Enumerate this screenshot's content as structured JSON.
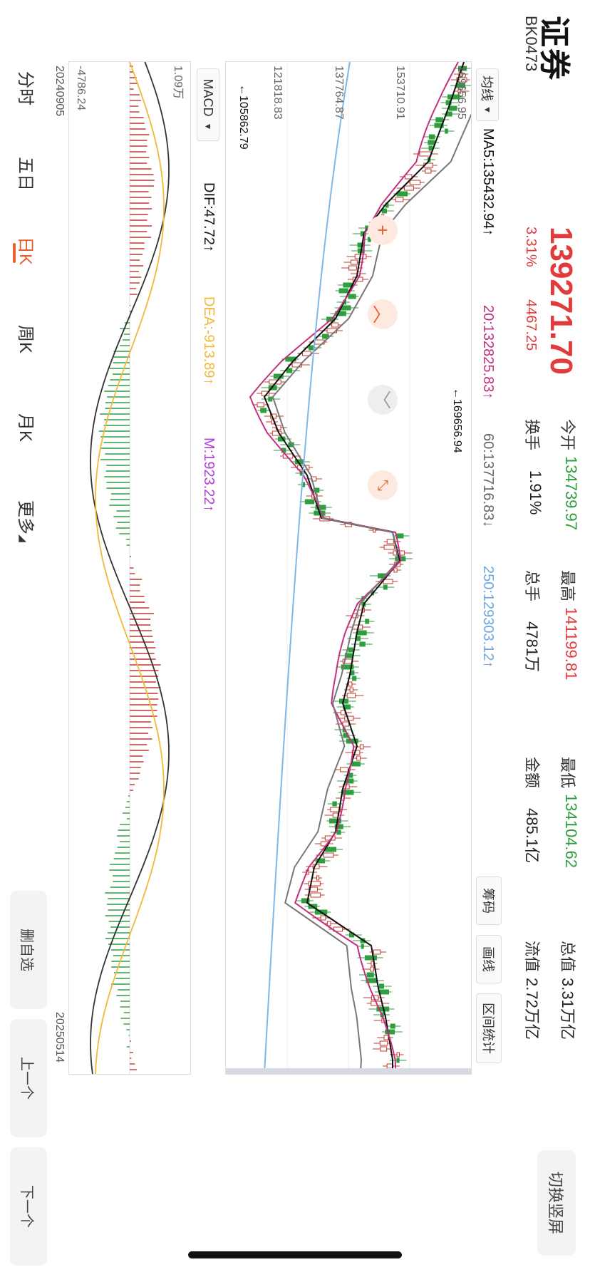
{
  "header": {
    "title": "证券",
    "code": "BK0473",
    "price": "139271.70",
    "change_pct": "3.31%",
    "change_abs": "4467.25",
    "stats": [
      {
        "label": "今开",
        "value": "134739.97",
        "color": "green"
      },
      {
        "label": "最高",
        "value": "141199.81",
        "color": "red"
      },
      {
        "label": "最低",
        "value": "134104.62",
        "color": "green"
      },
      {
        "label": "总值",
        "value": "3.31万亿",
        "color": "dark"
      },
      {
        "label": "换手",
        "value": "1.91%",
        "color": "dark"
      },
      {
        "label": "总手",
        "value": "4781万",
        "color": "dark"
      },
      {
        "label": "金额",
        "value": "485.1亿",
        "color": "dark"
      },
      {
        "label": "流值",
        "value": "2.72万亿",
        "color": "dark"
      }
    ],
    "switch_label": "切换竖屏"
  },
  "toolbar": {
    "ma_select": "均线",
    "ma5": "MA5:135432.94↑",
    "ma20": "20:132825.83↑",
    "ma60": "60:137716.83↓",
    "ma250": "250:129303.12↑",
    "chips_btn": "筹码",
    "draw_btn": "画线",
    "range_btn": "区间统计"
  },
  "kline": {
    "y_labels": [
      "169656.95",
      "153710.91",
      "137764.87",
      "121818.83"
    ],
    "high_marker": "←169656.94",
    "low_marker": "←105862.79"
  },
  "indicator": {
    "select": "MACD",
    "dif": "DIF:47.72↑",
    "dea": "DEA:-913.89↑",
    "m": "M:1923.22↑",
    "top_label": "1.09万",
    "bottom_label": "-4786.24"
  },
  "dates": {
    "start": "20240905",
    "end": "20250514"
  },
  "tabs": [
    {
      "label": "分时"
    },
    {
      "label": "五日"
    },
    {
      "label": "日K"
    },
    {
      "label": "周K"
    },
    {
      "label": "月K"
    },
    {
      "label": "更多"
    }
  ],
  "side_buttons": {
    "remove": "删自选",
    "prev": "上一个",
    "next": "下一个"
  },
  "colors": {
    "up": "#c0392b",
    "down": "#2e9e3e",
    "ma5": "#111111",
    "ma20": "#c2307f",
    "ma60": "#777777",
    "ma250": "#7fb8e8",
    "accent": "#e8602c",
    "dea": "#f0b93a",
    "m": "#b23fd6"
  }
}
